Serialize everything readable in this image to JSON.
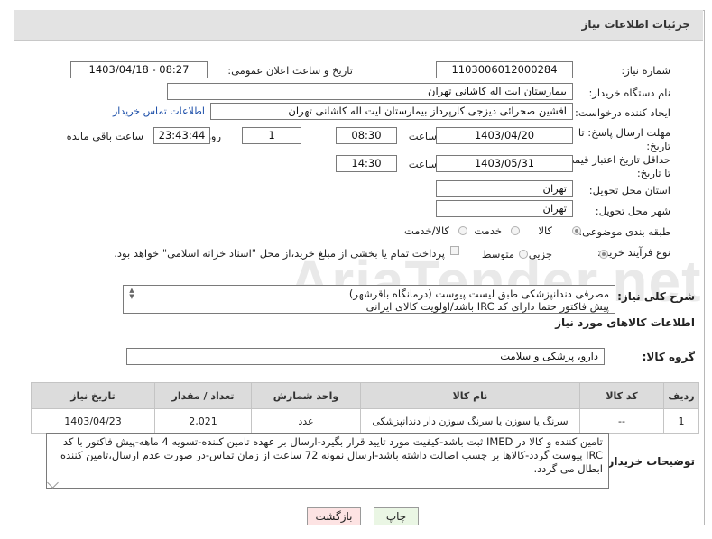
{
  "header": {
    "title": "جزئیات اطلاعات نیاز"
  },
  "watermark": "AriaTender.net",
  "fields": {
    "need_number_label": "شماره نیاز:",
    "need_number": "1103006012000284",
    "announce_label": "تاریخ و ساعت اعلان عمومی:",
    "announce_value": "1403/04/18 - 08:27",
    "buyer_org_label": "نام دستگاه خریدار:",
    "buyer_org": "بیمارستان ایت اله کاشانی تهران",
    "creator_label": "ایجاد کننده درخواست:",
    "creator": "افشین صحرائی دیزجی کارپرداز بیمارستان ایت اله کاشانی تهران",
    "contact_link": "اطلاعات تماس خریدار",
    "reply_deadline_label": "مهلت ارسال پاسخ: تا تاریخ:",
    "reply_date": "1403/04/20",
    "time_label": "ساعت",
    "reply_time": "08:30",
    "day_label": "روز و",
    "days": "1",
    "remaining_time": "23:43:44",
    "remaining_label": "ساعت باقی مانده",
    "price_validity_label": "حداقل تاریخ اعتبار قیمت: تا تاریخ:",
    "price_date": "1403/05/31",
    "price_time_label": "ساعت",
    "price_time": "14:30",
    "province_label": "استان محل تحویل:",
    "province": "تهران",
    "city_label": "شهر محل تحویل:",
    "city": "تهران",
    "category_label": "طبقه بندی موضوعی:",
    "category_options": [
      "کالا",
      "خدمت",
      "کالا/خدمت"
    ],
    "process_label": "نوع فرآیند خرید :",
    "process_options": [
      "جزیی",
      "متوسط"
    ],
    "payment_note": "پرداخت تمام یا بخشی از مبلغ خرید،از محل \"اسناد خزانه اسلامی\" خواهد بود."
  },
  "description": {
    "label": "شرح کلی نیاز:",
    "line1": "مصرفی دندانپزشکی طبق لیست پیوست (درمانگاه باقرشهر)",
    "line2": "پیش فاکتور حتما دارای کد IRC باشد/اولویت کالای ایرانی"
  },
  "goods_section": {
    "title": "اطلاعات کالاهای مورد نیاز",
    "group_label": "گروه کالا:",
    "group_value": "دارو، پزشکی و سلامت"
  },
  "table": {
    "headers": [
      "ردیف",
      "کد کالا",
      "نام کالا",
      "واحد شمارش",
      "تعداد / مقدار",
      "تاریخ نیاز"
    ],
    "rows": [
      [
        "1",
        "--",
        "سرنگ یا سوزن یا سرنگ سوزن دار دندانپزشکی",
        "عدد",
        "2,021",
        "1403/04/23"
      ]
    ]
  },
  "buyer_notes": {
    "label": "توضیحات خریدار:",
    "text": "تامین کننده و کالا در IMED ثبت باشد-کیفیت مورد تایید قرار بگیرد-ارسال بر عهده تامین کننده-تسویه 4 ماهه-پیش فاکتور با کد IRC پیوست گردد-کالاها بر چسب اصالت داشته باشد-ارسال نمونه 72 ساعت از زمان تماس-در صورت عدم ارسال،تامین کننده ابطال می گردد."
  },
  "buttons": {
    "print": "چاپ",
    "back": "بازگشت"
  },
  "colors": {
    "link": "#1a4da8",
    "back_button_bg": "#fde3e3",
    "print_button_bg": "#eaf6e4"
  }
}
